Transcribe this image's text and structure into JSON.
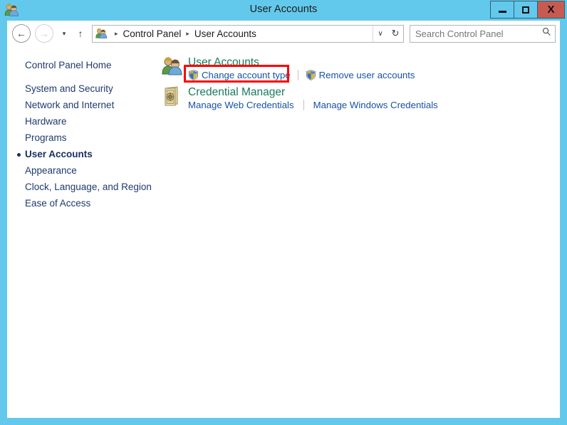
{
  "window": {
    "title": "User Accounts",
    "app_icon": "user-accounts-icon",
    "controls": {
      "minimize": "–",
      "maximize": "□",
      "close": "X"
    },
    "accent_color": "#63c9ec",
    "close_color": "#c75b52"
  },
  "toolbar": {
    "back": "←",
    "forward": "→",
    "recent": "▾",
    "up": "↑",
    "address_icon": "user-accounts-icon",
    "breadcrumbs": [
      "Control Panel",
      "User Accounts"
    ],
    "breadcrumb_separator": "▸",
    "dropdown": "∨",
    "refresh": "↻",
    "search_placeholder": "Search Control Panel",
    "search_value": "",
    "search_icon": "🔍"
  },
  "sidebar": {
    "home": "Control Panel Home",
    "items": [
      {
        "label": "System and Security",
        "active": false
      },
      {
        "label": "Network and Internet",
        "active": false
      },
      {
        "label": "Hardware",
        "active": false
      },
      {
        "label": "Programs",
        "active": false
      },
      {
        "label": "User Accounts",
        "active": true
      },
      {
        "label": "Appearance",
        "active": false
      },
      {
        "label": "Clock, Language, and Region",
        "active": false
      },
      {
        "label": "Ease of Access",
        "active": false
      }
    ]
  },
  "main": {
    "categories": [
      {
        "title": "User Accounts",
        "icon": "user-accounts-icon",
        "links": [
          {
            "label": "Change account type",
            "shield": true
          },
          {
            "label": "Remove user accounts",
            "shield": true
          }
        ]
      },
      {
        "title": "Credential Manager",
        "icon": "credential-manager-icon",
        "links": [
          {
            "label": "Manage Web Credentials",
            "shield": false
          },
          {
            "label": "Manage Windows Credentials",
            "shield": false
          }
        ]
      }
    ],
    "heading_color": "#1a7a5e",
    "link_color": "#1652a6"
  },
  "annotation": {
    "color": "#fe0000",
    "target": "Change account type"
  }
}
